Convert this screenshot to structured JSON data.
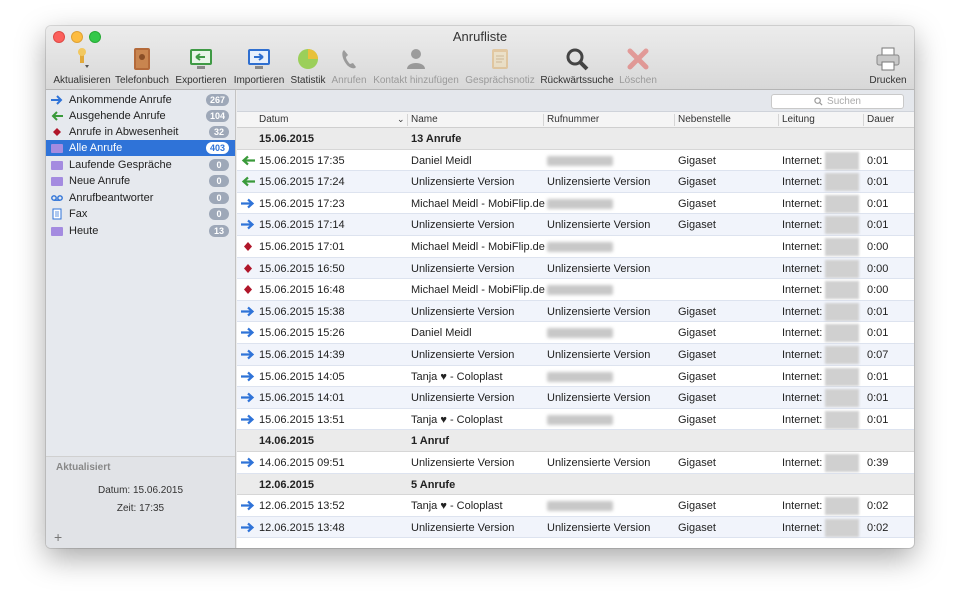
{
  "window": {
    "title": "Anrufliste"
  },
  "toolbar": {
    "refresh": "Aktualisieren",
    "phonebook": "Telefonbuch",
    "export": "Exportieren",
    "import": "Importieren",
    "stats": "Statistik",
    "call": "Anrufen",
    "add_contact": "Kontakt hinzufügen",
    "note": "Gesprächsnotiz",
    "reverse_search": "Rückwärtssuche",
    "delete": "Löschen",
    "print": "Drucken"
  },
  "sidebar": {
    "items": [
      {
        "label": "Ankommende Anrufe",
        "count": "267"
      },
      {
        "label": "Ausgehende Anrufe",
        "count": "104"
      },
      {
        "label": "Anrufe in Abwesenheit",
        "count": "32"
      },
      {
        "label": "Alle Anrufe",
        "count": "403"
      },
      {
        "label": "Laufende Gespräche",
        "count": "0"
      },
      {
        "label": "Neue Anrufe",
        "count": "0"
      },
      {
        "label": "Anrufbeantworter",
        "count": "0"
      },
      {
        "label": "Fax",
        "count": "0"
      },
      {
        "label": "Heute",
        "count": "13"
      }
    ],
    "footer": {
      "title": "Aktualisiert",
      "date": "Datum: 15.06.2015",
      "time": "Zeit: 17:35",
      "add": "+"
    }
  },
  "search": {
    "placeholder": "Suchen"
  },
  "columns": {
    "date": "Datum",
    "name": "Name",
    "number": "Rufnummer",
    "extension": "Nebenstelle",
    "line": "Leitung",
    "duration": "Dauer"
  },
  "colors": {
    "incoming": "#2f73d8",
    "outgoing": "#3a9a3a",
    "missed": "#b0162a",
    "selection": "#2f73d8"
  },
  "rows": [
    {
      "group": true,
      "date": "15.06.2015",
      "name": "13 Anrufe"
    },
    {
      "dir": "outgoing",
      "date": "15.06.2015 17:35",
      "name": "Daniel Meidl",
      "number": "",
      "ext": "Gigaset",
      "line": "Internet:",
      "dur": "0:01"
    },
    {
      "dir": "outgoing",
      "date": "15.06.2015 17:24",
      "name": "Unlizensierte Version",
      "number": "Unlizensierte Version",
      "ext": "Gigaset",
      "line": "Internet:",
      "dur": "0:01"
    },
    {
      "dir": "incoming",
      "date": "15.06.2015 17:23",
      "name": "Michael Meidl - MobiFlip.de",
      "number": "",
      "ext": "Gigaset",
      "line": "Internet:",
      "dur": "0:01"
    },
    {
      "dir": "incoming",
      "date": "15.06.2015 17:14",
      "name": "Unlizensierte Version",
      "number": "Unlizensierte Version",
      "ext": "Gigaset",
      "line": "Internet:",
      "dur": "0:01"
    },
    {
      "dir": "missed",
      "date": "15.06.2015 17:01",
      "name": "Michael Meidl - MobiFlip.de",
      "number": "",
      "ext": "",
      "line": "Internet:",
      "dur": "0:00"
    },
    {
      "dir": "missed",
      "date": "15.06.2015 16:50",
      "name": "Unlizensierte Version",
      "number": "Unlizensierte Version",
      "ext": "",
      "line": "Internet:",
      "dur": "0:00"
    },
    {
      "dir": "missed",
      "date": "15.06.2015 16:48",
      "name": "Michael Meidl - MobiFlip.de",
      "number": "",
      "ext": "",
      "line": "Internet:",
      "dur": "0:00"
    },
    {
      "dir": "incoming",
      "date": "15.06.2015 15:38",
      "name": "Unlizensierte Version",
      "number": "Unlizensierte Version",
      "ext": "Gigaset",
      "line": "Internet:",
      "dur": "0:01"
    },
    {
      "dir": "incoming",
      "date": "15.06.2015 15:26",
      "name": "Daniel Meidl",
      "number": "",
      "ext": "Gigaset",
      "line": "Internet:",
      "dur": "0:01"
    },
    {
      "dir": "incoming",
      "date": "15.06.2015 14:39",
      "name": "Unlizensierte Version",
      "number": "Unlizensierte Version",
      "ext": "Gigaset",
      "line": "Internet:",
      "dur": "0:07"
    },
    {
      "dir": "incoming",
      "date": "15.06.2015 14:05",
      "name": "Tanja ♥ - Coloplast",
      "number": "",
      "ext": "Gigaset",
      "line": "Internet:",
      "dur": "0:01"
    },
    {
      "dir": "incoming",
      "date": "15.06.2015 14:01",
      "name": "Unlizensierte Version",
      "number": "Unlizensierte Version",
      "ext": "Gigaset",
      "line": "Internet:",
      "dur": "0:01"
    },
    {
      "dir": "incoming",
      "date": "15.06.2015 13:51",
      "name": "Tanja ♥ - Coloplast",
      "number": "",
      "ext": "Gigaset",
      "line": "Internet:",
      "dur": "0:01"
    },
    {
      "group": true,
      "date": "14.06.2015",
      "name": "1 Anruf"
    },
    {
      "dir": "incoming",
      "date": "14.06.2015 09:51",
      "name": "Unlizensierte Version",
      "number": "Unlizensierte Version",
      "ext": "Gigaset",
      "line": "Internet:",
      "dur": "0:39"
    },
    {
      "group": true,
      "date": "12.06.2015",
      "name": "5 Anrufe"
    },
    {
      "dir": "incoming",
      "date": "12.06.2015 13:52",
      "name": "Tanja ♥ - Coloplast",
      "number": "",
      "ext": "Gigaset",
      "line": "Internet:",
      "dur": "0:02"
    },
    {
      "dir": "incoming",
      "date": "12.06.2015 13:48",
      "name": "Unlizensierte Version",
      "number": "Unlizensierte Version",
      "ext": "Gigaset",
      "line": "Internet:",
      "dur": "0:02"
    }
  ]
}
